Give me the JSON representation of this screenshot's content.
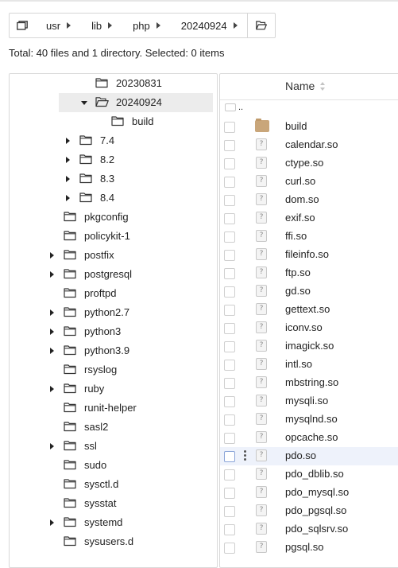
{
  "breadcrumb": {
    "home_icon": "folder-tree-icon",
    "segments": [
      "usr",
      "lib",
      "php",
      "20240924"
    ],
    "open_icon": "open-folder-icon"
  },
  "summary": "Total: 40 files and 1 directory. Selected: 0 items",
  "tree": {
    "nodes": [
      {
        "label": "20230831",
        "level": 2,
        "expander": "none",
        "open": false
      },
      {
        "label": "20240924",
        "level": 2,
        "expander": "expanded",
        "open": true,
        "selected": true
      },
      {
        "label": "build",
        "level": 3,
        "expander": "none",
        "open": false
      },
      {
        "label": "7.4",
        "level": 1,
        "expander": "collapsed",
        "open": false
      },
      {
        "label": "8.2",
        "level": 1,
        "expander": "collapsed",
        "open": false
      },
      {
        "label": "8.3",
        "level": 1,
        "expander": "collapsed",
        "open": false
      },
      {
        "label": "8.4",
        "level": 1,
        "expander": "collapsed",
        "open": false
      },
      {
        "label": "pkgconfig",
        "level": 0,
        "expander": "none",
        "open": false
      },
      {
        "label": "policykit-1",
        "level": 0,
        "expander": "none",
        "open": false
      },
      {
        "label": "postfix",
        "level": 0,
        "expander": "collapsed",
        "open": false
      },
      {
        "label": "postgresql",
        "level": 0,
        "expander": "collapsed",
        "open": false
      },
      {
        "label": "proftpd",
        "level": 0,
        "expander": "none",
        "open": false
      },
      {
        "label": "python2.7",
        "level": 0,
        "expander": "collapsed",
        "open": false
      },
      {
        "label": "python3",
        "level": 0,
        "expander": "collapsed",
        "open": false
      },
      {
        "label": "python3.9",
        "level": 0,
        "expander": "collapsed",
        "open": false
      },
      {
        "label": "rsyslog",
        "level": 0,
        "expander": "none",
        "open": false
      },
      {
        "label": "ruby",
        "level": 0,
        "expander": "collapsed",
        "open": false
      },
      {
        "label": "runit-helper",
        "level": 0,
        "expander": "none",
        "open": false
      },
      {
        "label": "sasl2",
        "level": 0,
        "expander": "none",
        "open": false
      },
      {
        "label": "ssl",
        "level": 0,
        "expander": "collapsed",
        "open": false
      },
      {
        "label": "sudo",
        "level": 0,
        "expander": "none",
        "open": false
      },
      {
        "label": "sysctl.d",
        "level": 0,
        "expander": "none",
        "open": false
      },
      {
        "label": "sysstat",
        "level": 0,
        "expander": "none",
        "open": false
      },
      {
        "label": "systemd",
        "level": 0,
        "expander": "collapsed",
        "open": false
      },
      {
        "label": "sysusers.d",
        "level": 0,
        "expander": "none",
        "open": false
      }
    ]
  },
  "list": {
    "column_name": "Name",
    "parent_label": "..",
    "rows": [
      {
        "name": "build",
        "type": "folder"
      },
      {
        "name": "calendar.so",
        "type": "file"
      },
      {
        "name": "ctype.so",
        "type": "file"
      },
      {
        "name": "curl.so",
        "type": "file"
      },
      {
        "name": "dom.so",
        "type": "file"
      },
      {
        "name": "exif.so",
        "type": "file"
      },
      {
        "name": "ffi.so",
        "type": "file"
      },
      {
        "name": "fileinfo.so",
        "type": "file"
      },
      {
        "name": "ftp.so",
        "type": "file"
      },
      {
        "name": "gd.so",
        "type": "file"
      },
      {
        "name": "gettext.so",
        "type": "file"
      },
      {
        "name": "iconv.so",
        "type": "file"
      },
      {
        "name": "imagick.so",
        "type": "file"
      },
      {
        "name": "intl.so",
        "type": "file"
      },
      {
        "name": "mbstring.so",
        "type": "file"
      },
      {
        "name": "mysqli.so",
        "type": "file"
      },
      {
        "name": "mysqlnd.so",
        "type": "file"
      },
      {
        "name": "opcache.so",
        "type": "file"
      },
      {
        "name": "pdo.so",
        "type": "file",
        "hovered": true
      },
      {
        "name": "pdo_dblib.so",
        "type": "file"
      },
      {
        "name": "pdo_mysql.so",
        "type": "file"
      },
      {
        "name": "pdo_pgsql.so",
        "type": "file"
      },
      {
        "name": "pdo_sqlsrv.so",
        "type": "file"
      },
      {
        "name": "pgsql.so",
        "type": "file"
      }
    ]
  },
  "colors": {
    "folder": "#c9a67a",
    "hover_row": "#eef2fb",
    "selected_tree": "#ececec",
    "border": "#d6d6d6"
  }
}
